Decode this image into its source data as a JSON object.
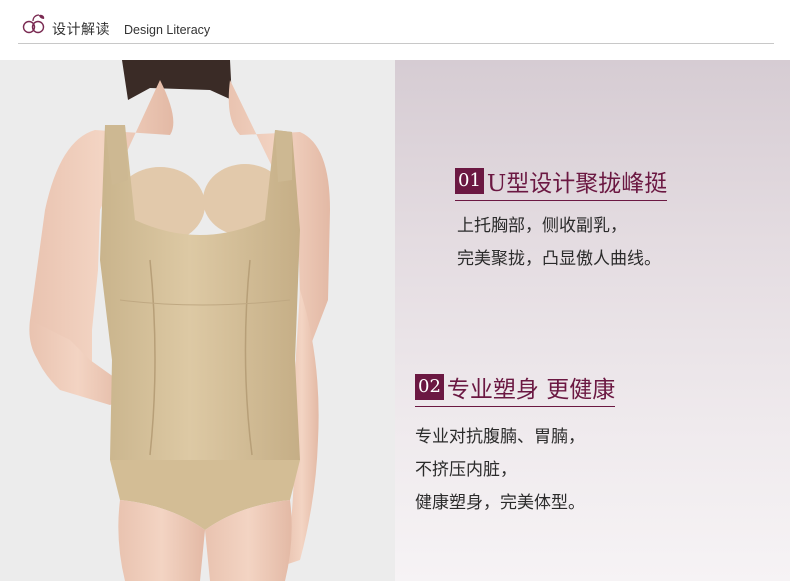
{
  "header": {
    "title_cn": "设计解读",
    "title_en": "Design Literacy",
    "icon": "grape-logo-icon"
  },
  "colors": {
    "accent": "#6b1842",
    "panel_bg": "#e4dce1",
    "photo_bg": "#ececec",
    "garment": "#d8c49e"
  },
  "photo": {
    "subject": "model-wearing-shapewear-vest"
  },
  "features": [
    {
      "number": "01",
      "title": "U型设计聚拢峰挺",
      "lines": [
        "上托胸部，侧收副乳，",
        "完美聚拢，凸显傲人曲线。"
      ]
    },
    {
      "number": "02",
      "title": "专业塑身 更健康",
      "lines": [
        "专业对抗腹腩、胃腩，",
        "不挤压内脏，",
        "健康塑身，完美体型。"
      ]
    }
  ]
}
